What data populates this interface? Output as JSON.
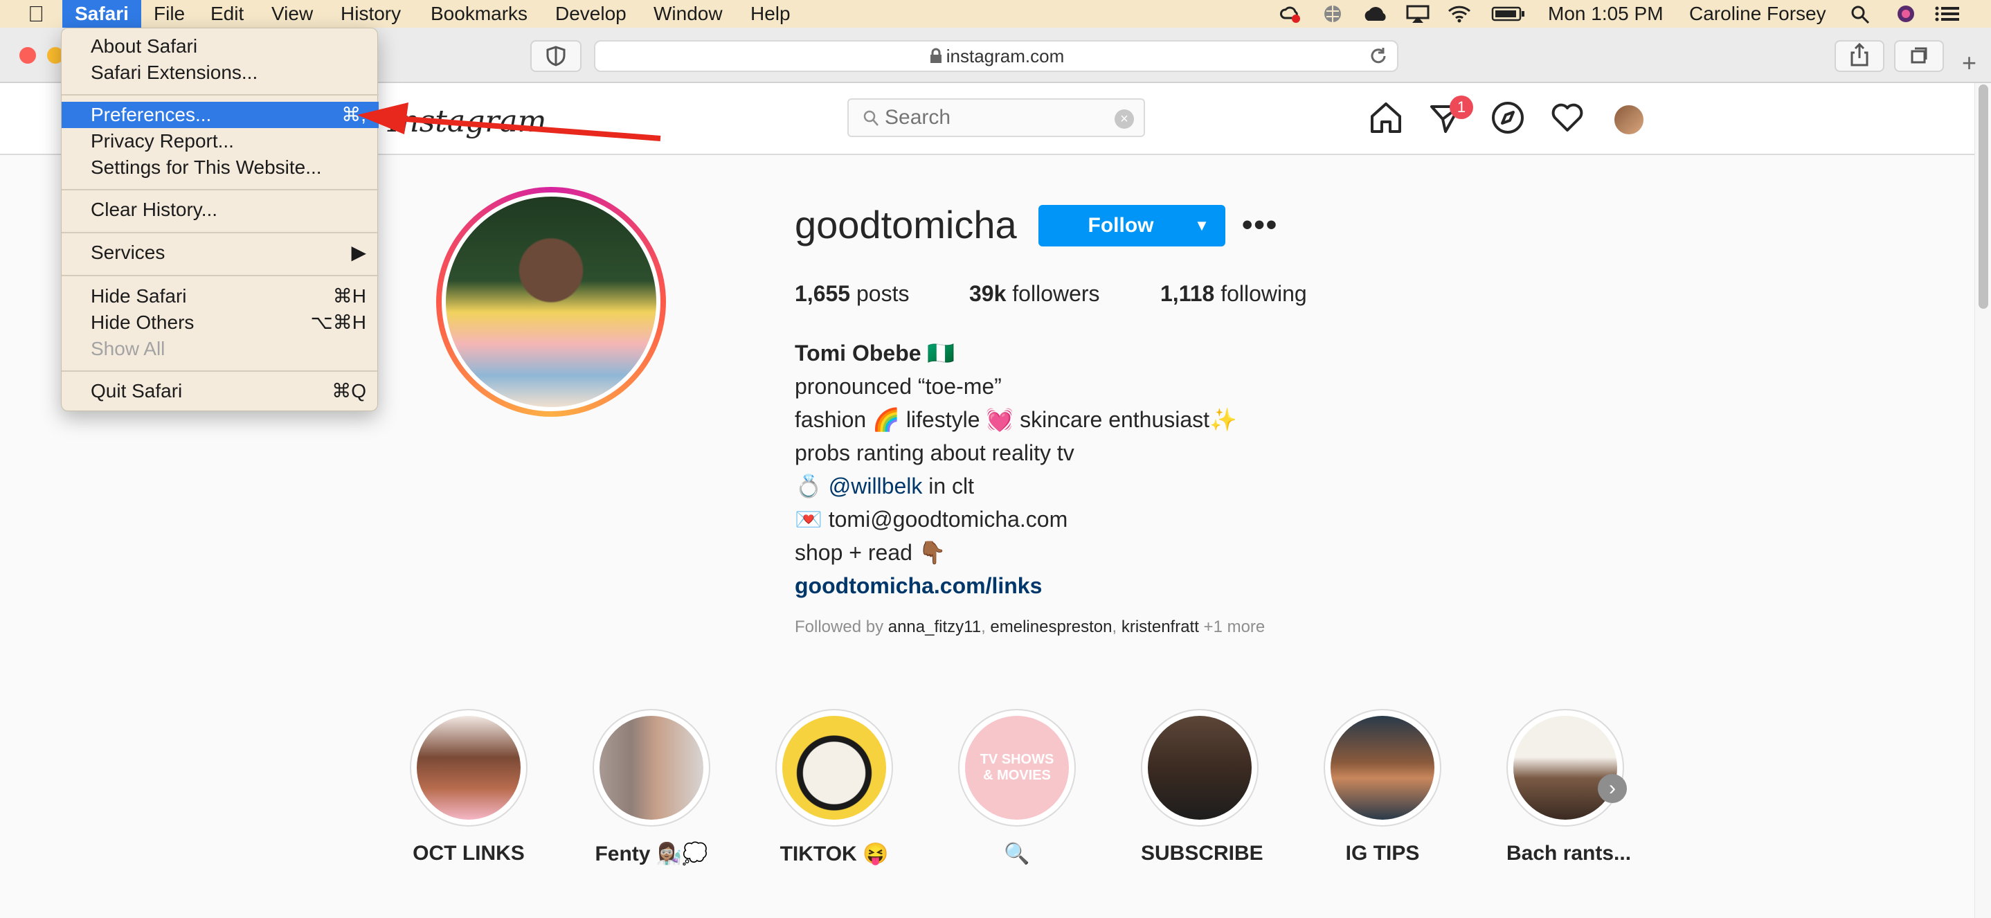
{
  "menubar": {
    "app": "Safari",
    "items": [
      "File",
      "Edit",
      "View",
      "History",
      "Bookmarks",
      "Develop",
      "Window",
      "Help"
    ],
    "clock": "Mon 1:05 PM",
    "user": "Caroline Forsey"
  },
  "browser": {
    "url": "instagram.com"
  },
  "safari_menu": {
    "items": [
      {
        "label": "About Safari",
        "shortcut": ""
      },
      {
        "label": "Safari Extensions...",
        "shortcut": ""
      },
      {
        "label": "Preferences...",
        "shortcut": "⌘,"
      },
      {
        "label": "Privacy Report...",
        "shortcut": ""
      },
      {
        "label": "Settings for This Website...",
        "shortcut": ""
      },
      {
        "label": "Clear History...",
        "shortcut": ""
      },
      {
        "label": "Services",
        "shortcut": "▶"
      },
      {
        "label": "Hide Safari",
        "shortcut": "⌘H"
      },
      {
        "label": "Hide Others",
        "shortcut": "⌥⌘H"
      },
      {
        "label": "Show All",
        "shortcut": ""
      },
      {
        "label": "Quit Safari",
        "shortcut": "⌘Q"
      }
    ]
  },
  "instagram": {
    "logo": "Instagram",
    "search_placeholder": "Search",
    "dm_badge": "1",
    "profile": {
      "username": "goodtomicha",
      "follow_label": "Follow",
      "posts_count": "1,655",
      "posts_label": "posts",
      "followers_count": "39k",
      "followers_label": "followers",
      "following_count": "1,118",
      "following_label": "following",
      "bio": {
        "name": "Tomi Obebe 🇳🇬",
        "line1": "pronounced “toe-me”",
        "line2": "fashion 🌈 lifestyle 💓 skincare enthusiast✨",
        "line3": "probs ranting about reality tv",
        "line4_prefix": "💍 ",
        "line4_mention": "@willbelk",
        "line4_suffix": " in clt",
        "line5": "💌 tomi@goodtomicha.com",
        "line6": "shop + read 👇🏾",
        "link": "goodtomicha.com/links"
      },
      "followed_by_prefix": "Followed by ",
      "followed_by": [
        "anna_fitzy11",
        "emelinespreston",
        "kristenfratt"
      ],
      "followed_more": " +1 more"
    },
    "highlights": [
      {
        "label": "OCT LINKS"
      },
      {
        "label": "Fenty 👩🏽‍🔬💭"
      },
      {
        "label": "TIKTOK 😝"
      },
      {
        "label": "🔍",
        "cover_text": "TV SHOWS & MOVIES"
      },
      {
        "label": "SUBSCRIBE"
      },
      {
        "label": "IG TIPS"
      },
      {
        "label": "Bach rants..."
      }
    ]
  }
}
